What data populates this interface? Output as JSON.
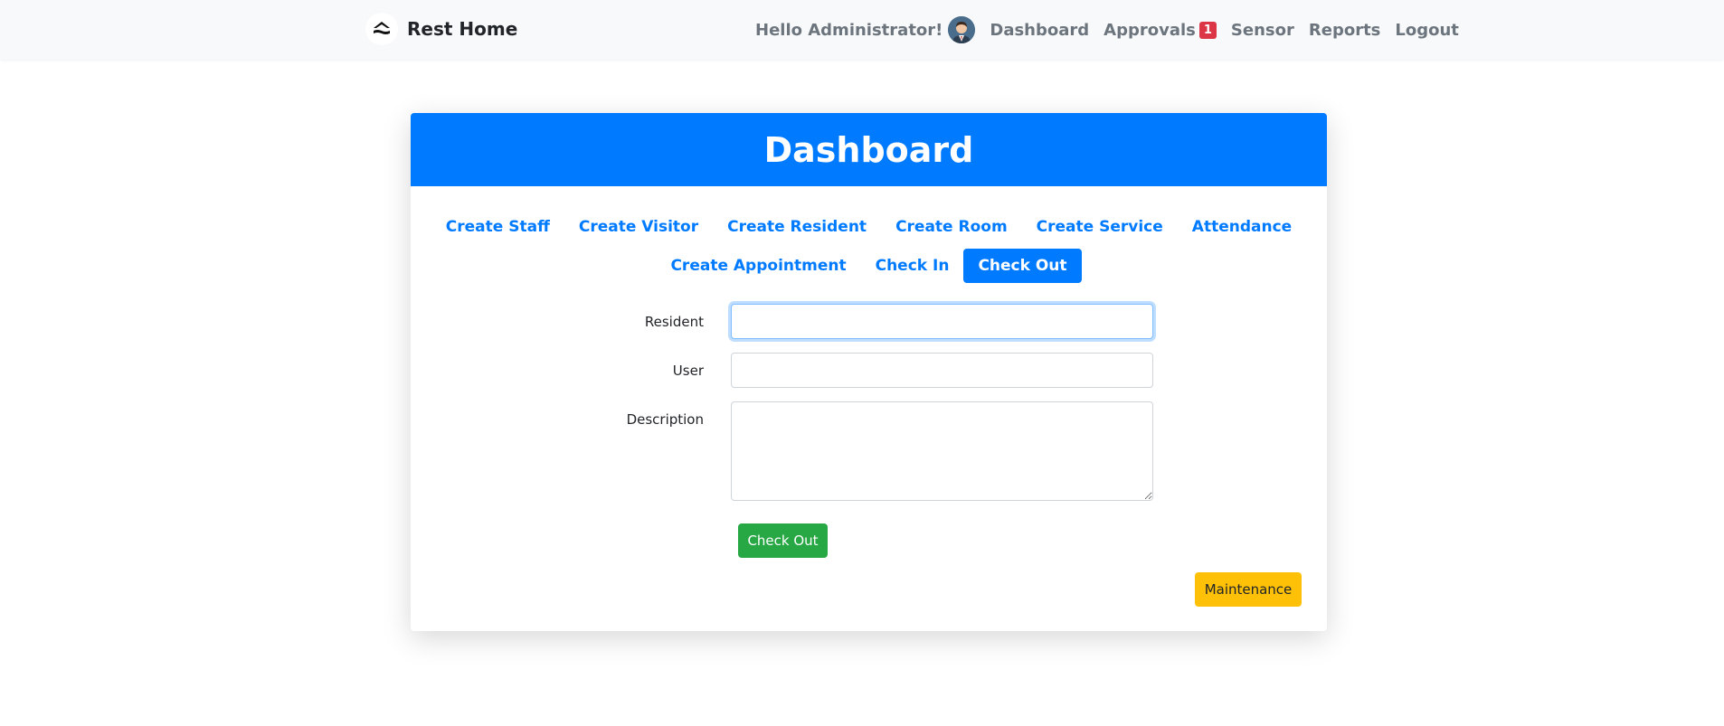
{
  "navbar": {
    "brand": "Rest Home",
    "greeting": "Hello Administrator!",
    "links": {
      "dashboard": "Dashboard",
      "approvals": "Approvals",
      "approvals_badge": "1",
      "sensor": "Sensor",
      "reports": "Reports",
      "logout": "Logout"
    }
  },
  "card": {
    "title": "Dashboard",
    "menu_row1": [
      "Create Staff",
      "Create Visitor",
      "Create Resident",
      "Create Room",
      "Create Service",
      "Attendance"
    ],
    "menu_row2": [
      "Create Appointment",
      "Check In",
      "Check Out"
    ],
    "active_menu": "Check Out"
  },
  "form": {
    "resident_label": "Resident",
    "resident_value": "",
    "user_label": "User",
    "user_value": "",
    "description_label": "Description",
    "description_value": "",
    "submit_label": "Check Out"
  },
  "maintenance_label": "Maintenance",
  "colors": {
    "primary": "#007bff",
    "success": "#28a745",
    "warning": "#ffc107",
    "danger": "#dc3545"
  },
  "icons": {
    "brand": "home-hands-icon",
    "avatar": "user-avatar"
  }
}
